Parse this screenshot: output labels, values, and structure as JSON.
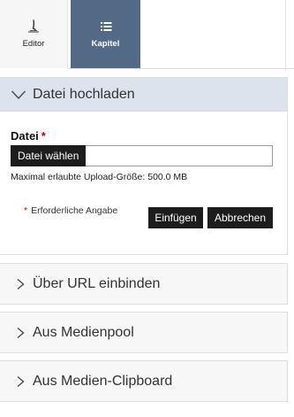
{
  "tabs": {
    "editor": {
      "label": "Editor",
      "icon": "quill-pen-icon",
      "active": false
    },
    "kapitel": {
      "label": "Kapitel",
      "icon": "list-icon",
      "active": true,
      "color": "#536a87"
    }
  },
  "upload": {
    "title": "Datei hochladen",
    "expanded": true,
    "field_label": "Datei",
    "required_mark": "*",
    "choose_file_label": "Datei wählen",
    "file_name": "",
    "max_size_text": "Maximal erlaubte Upload-Größe: 500.0 MB",
    "required_note": "Erforderliche Angabe",
    "insert_label": "Einfügen",
    "cancel_label": "Abbrechen"
  },
  "sections": {
    "url": {
      "title": "Über URL einbinden",
      "expanded": false
    },
    "medienpool": {
      "title": "Aus Medienpool",
      "expanded": false
    },
    "clipboard": {
      "title": "Aus Medien-Clipboard",
      "expanded": false
    }
  },
  "colors": {
    "accent": "#536a87",
    "open_header": "#dde3ec",
    "button": "#1d1d1d",
    "required": "#c00000"
  }
}
